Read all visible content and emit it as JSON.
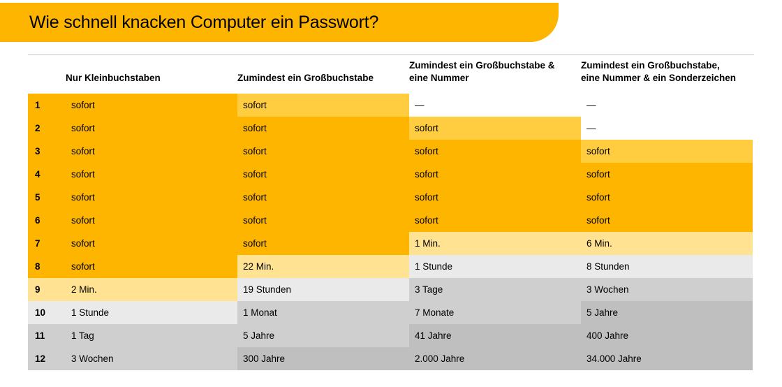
{
  "title": "Wie schnell knacken Computer ein Passwort?",
  "headers": [
    "Nur Kleinbuchstaben",
    "Zumindest ein Großbuchstabe",
    "Zumindest ein Großbuchstabe & eine Nummer",
    "Zumindest ein Großbuchstabe, eine Nummer & ein Sonderzeichen"
  ],
  "rows": [
    {
      "n": "1",
      "c": [
        "sofort",
        "sofort",
        "—",
        "—"
      ],
      "num_cls": "c-orange",
      "cls": [
        "c-orange",
        "c-yellow",
        "c-white",
        "c-white"
      ]
    },
    {
      "n": "2",
      "c": [
        "sofort",
        "sofort",
        "sofort",
        "—"
      ],
      "num_cls": "c-orange",
      "cls": [
        "c-orange",
        "c-orange",
        "c-yellow",
        "c-white"
      ]
    },
    {
      "n": "3",
      "c": [
        "sofort",
        "sofort",
        "sofort",
        "sofort"
      ],
      "num_cls": "c-orange",
      "cls": [
        "c-orange",
        "c-orange",
        "c-orange",
        "c-yellow"
      ]
    },
    {
      "n": "4",
      "c": [
        "sofort",
        "sofort",
        "sofort",
        "sofort"
      ],
      "num_cls": "c-orange",
      "cls": [
        "c-orange",
        "c-orange",
        "c-orange",
        "c-orange"
      ]
    },
    {
      "n": "5",
      "c": [
        "sofort",
        "sofort",
        "sofort",
        "sofort"
      ],
      "num_cls": "c-orange",
      "cls": [
        "c-orange",
        "c-orange",
        "c-orange",
        "c-orange"
      ]
    },
    {
      "n": "6",
      "c": [
        "sofort",
        "sofort",
        "sofort",
        "sofort"
      ],
      "num_cls": "c-orange",
      "cls": [
        "c-orange",
        "c-orange",
        "c-orange",
        "c-orange"
      ]
    },
    {
      "n": "7",
      "c": [
        "sofort",
        "sofort",
        "1 Min.",
        "6 Min."
      ],
      "num_cls": "c-orange",
      "cls": [
        "c-orange",
        "c-orange",
        "c-light",
        "c-light"
      ]
    },
    {
      "n": "8",
      "c": [
        "sofort",
        "22 Min.",
        "1 Stunde",
        "8 Stunden"
      ],
      "num_cls": "c-orange",
      "cls": [
        "c-orange",
        "c-light",
        "c-grey1",
        "c-grey1"
      ]
    },
    {
      "n": "9",
      "c": [
        "2 Min.",
        "19 Stunden",
        "3 Tage",
        "3 Wochen"
      ],
      "num_cls": "c-light",
      "cls": [
        "c-light",
        "c-grey1",
        "c-grey2",
        "c-grey2"
      ]
    },
    {
      "n": "10",
      "c": [
        "1 Stunde",
        "1 Monat",
        "7 Monate",
        "5 Jahre"
      ],
      "num_cls": "c-grey1",
      "cls": [
        "c-grey1",
        "c-grey2",
        "c-grey2",
        "c-grey3"
      ]
    },
    {
      "n": "11",
      "c": [
        "1 Tag",
        "5 Jahre",
        "41 Jahre",
        "400 Jahre"
      ],
      "num_cls": "c-grey2",
      "cls": [
        "c-grey2",
        "c-grey2",
        "c-grey3",
        "c-grey3"
      ]
    },
    {
      "n": "12",
      "c": [
        "3 Wochen",
        "300 Jahre",
        "2.000 Jahre",
        "34.000 Jahre"
      ],
      "num_cls": "c-grey2",
      "cls": [
        "c-grey2",
        "c-grey3",
        "c-grey3",
        "c-grey3"
      ]
    }
  ]
}
